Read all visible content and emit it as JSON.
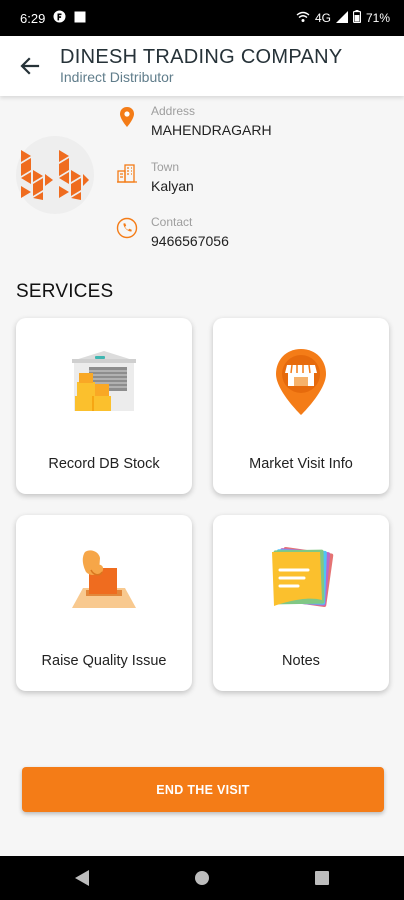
{
  "status_bar": {
    "time": "6:29",
    "network": "4G",
    "battery": "71%"
  },
  "header": {
    "title": "DINESH TRADING COMPANY",
    "subtitle": "Indirect Distributor"
  },
  "distributor": {
    "address": {
      "label": "Address",
      "value": "MAHENDRAGARH"
    },
    "town": {
      "label": "Town",
      "value": "Kalyan"
    },
    "contact": {
      "label": "Contact",
      "value": "9466567056"
    }
  },
  "services": {
    "title": "SERVICES",
    "items": [
      {
        "label": "Record DB Stock",
        "icon": "warehouse-icon"
      },
      {
        "label": "Market Visit Info",
        "icon": "store-location-icon"
      },
      {
        "label": "Raise Quality Issue",
        "icon": "ballot-box-icon"
      },
      {
        "label": "Notes",
        "icon": "sticky-notes-icon"
      }
    ]
  },
  "actions": {
    "end_visit": "END THE VISIT"
  },
  "colors": {
    "accent": "#f47c17",
    "title": "#263238",
    "subtitle": "#607d8b"
  }
}
